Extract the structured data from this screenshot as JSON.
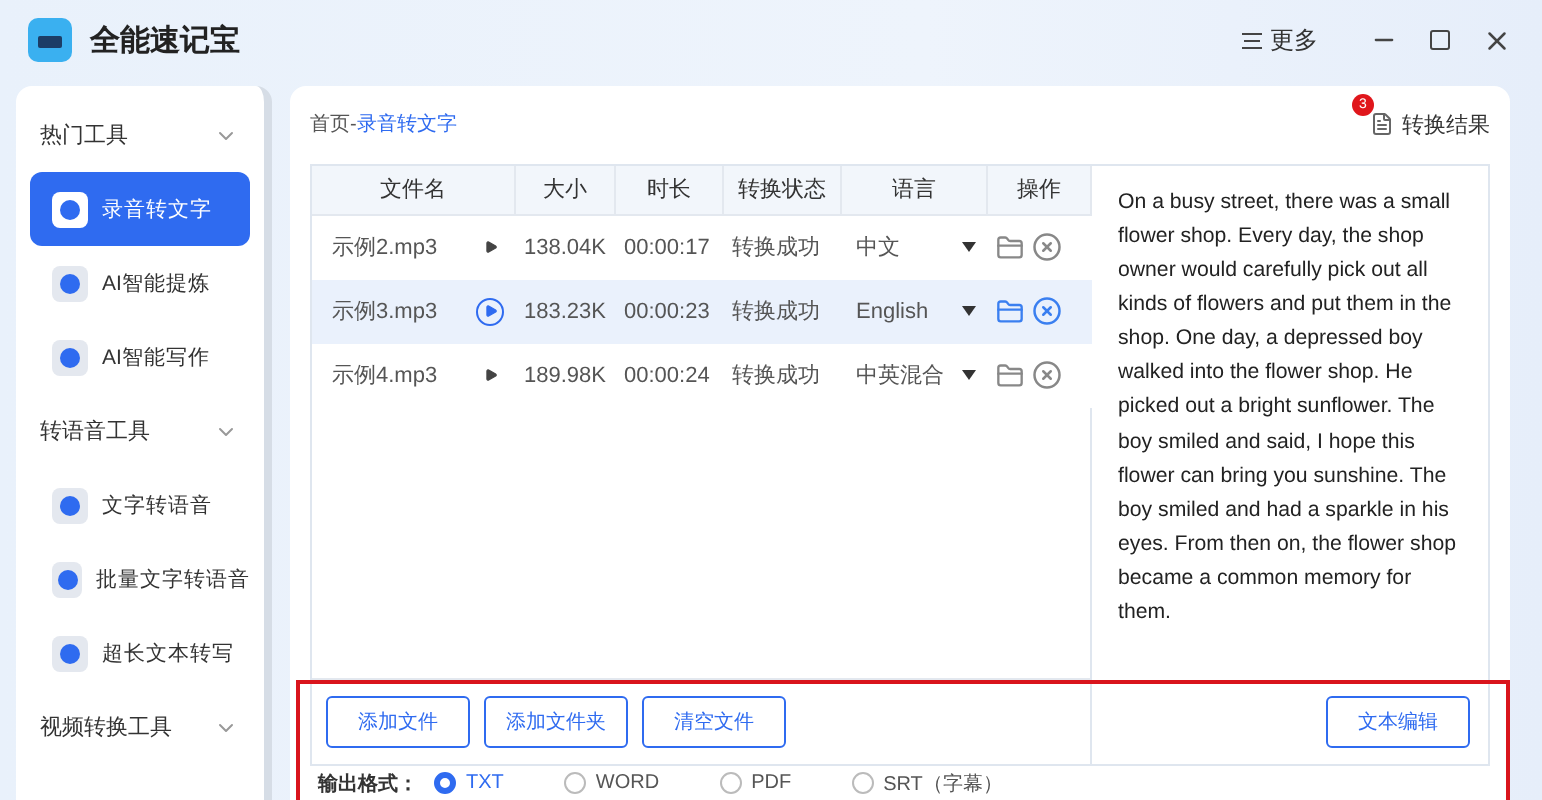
{
  "window": {
    "title": "全能速记宝",
    "menu_label": "更多"
  },
  "sidebar": {
    "groups": [
      {
        "title": "热门工具",
        "items": [
          {
            "label": "录音转文字",
            "selected": true
          },
          {
            "label": "AI智能提炼",
            "selected": false
          },
          {
            "label": "AI智能写作",
            "selected": false
          }
        ]
      },
      {
        "title": "转语音工具",
        "items": [
          {
            "label": "文字转语音",
            "selected": false
          },
          {
            "label": "批量文字转语音",
            "selected": false
          },
          {
            "label": "超长文本转写",
            "selected": false
          }
        ]
      },
      {
        "title": "视频转换工具"
      }
    ]
  },
  "breadcrumb": {
    "home": "首页",
    "separator": "-",
    "current": "录音转文字"
  },
  "results": {
    "label": "转换结果",
    "badge": "3"
  },
  "table": {
    "columns": [
      "文件名",
      "大小",
      "时长",
      "转换状态",
      "语言",
      "操作"
    ],
    "rows": [
      {
        "name": "示例2.mp3",
        "size": "138.04K",
        "duration": "00:00:17",
        "status": "转换成功",
        "language": "中文",
        "selected": false
      },
      {
        "name": "示例3.mp3",
        "size": "183.23K",
        "duration": "00:00:23",
        "status": "转换成功",
        "language": "English",
        "selected": true
      },
      {
        "name": "示例4.mp3",
        "size": "189.98K",
        "duration": "00:00:24",
        "status": "转换成功",
        "language": "中英混合",
        "selected": false
      }
    ]
  },
  "transcript": "On a busy street, there was a small flower shop. Every day, the shop owner would carefully pick out all kinds of flowers and put them in the shop. One day, a depressed boy walked into the flower shop. He picked out a bright sunflower. The boy smiled and said, I hope this flower can bring you sunshine. The boy smiled and had a sparkle in his eyes. From then on, the flower shop became a common memory for them.",
  "file_buttons": [
    "添加文件",
    "添加文件夹",
    "清空文件"
  ],
  "edit_button": "文本编辑",
  "output_format": {
    "label": "输出格式：",
    "options": [
      {
        "label": "TXT",
        "selected": true
      },
      {
        "label": "WORD",
        "selected": false
      },
      {
        "label": "PDF",
        "selected": false
      },
      {
        "label": "SRT（字幕）",
        "selected": false
      }
    ]
  }
}
